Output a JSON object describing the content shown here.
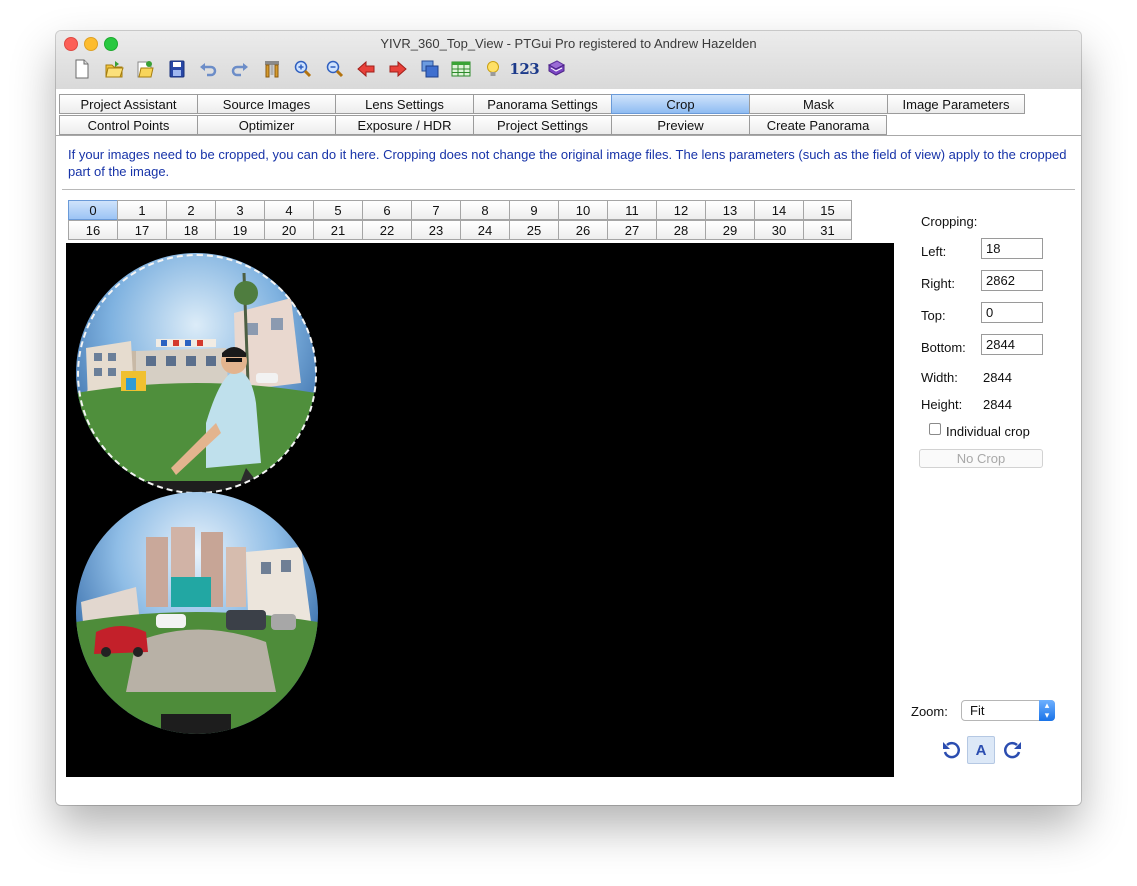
{
  "window": {
    "title": "YIVR_360_Top_View - PTGui Pro registered to Andrew Hazelden"
  },
  "toolbar": {
    "items": [
      {
        "name": "new-project-icon"
      },
      {
        "name": "open-project-icon"
      },
      {
        "name": "open-recent-icon"
      },
      {
        "name": "save-project-icon"
      },
      {
        "name": "undo-icon"
      },
      {
        "name": "redo-icon"
      },
      {
        "name": "tools-icon"
      },
      {
        "name": "zoom-in-icon"
      },
      {
        "name": "zoom-out-icon"
      },
      {
        "name": "arrow-left-icon"
      },
      {
        "name": "arrow-right-icon"
      },
      {
        "name": "images-icon"
      },
      {
        "name": "table-icon"
      },
      {
        "name": "lightbulb-icon"
      },
      {
        "name": "numbering-icon"
      },
      {
        "name": "help-book-icon"
      }
    ],
    "numbering_text": "123"
  },
  "tabs": {
    "row1": [
      "Project Assistant",
      "Source Images",
      "Lens Settings",
      "Panorama Settings",
      "Crop",
      "Mask",
      "Image Parameters"
    ],
    "row2": [
      "Control Points",
      "Optimizer",
      "Exposure / HDR",
      "Project Settings",
      "Preview",
      "Create Panorama"
    ],
    "active": "Crop"
  },
  "info_text": "If your images need to be cropped, you can do it here. Cropping does not change the original image files. The lens parameters (such as the field of view) apply to the cropped part of the image.",
  "image_numbers": {
    "row1": [
      "0",
      "1",
      "2",
      "3",
      "4",
      "5",
      "6",
      "7",
      "8",
      "9",
      "10",
      "11",
      "12",
      "13",
      "14",
      "15"
    ],
    "row2": [
      "16",
      "17",
      "18",
      "19",
      "20",
      "21",
      "22",
      "23",
      "24",
      "25",
      "26",
      "27",
      "28",
      "29",
      "30",
      "31"
    ],
    "selected": "0"
  },
  "cropping": {
    "heading": "Cropping:",
    "left_label": "Left:",
    "left_value": "18",
    "right_label": "Right:",
    "right_value": "2862",
    "top_label": "Top:",
    "top_value": "0",
    "bottom_label": "Bottom:",
    "bottom_value": "2844",
    "width_label": "Width:",
    "width_value": "2844",
    "height_label": "Height:",
    "height_value": "2844",
    "individual_crop_label": "Individual crop",
    "individual_crop_checked": false,
    "no_crop_button": "No Crop"
  },
  "zoom": {
    "label": "Zoom:",
    "value": "Fit"
  },
  "rotation": {
    "rotate_left_icon": "rotate-left-icon",
    "auto_label": "A",
    "rotate_right_icon": "rotate-right-icon"
  }
}
